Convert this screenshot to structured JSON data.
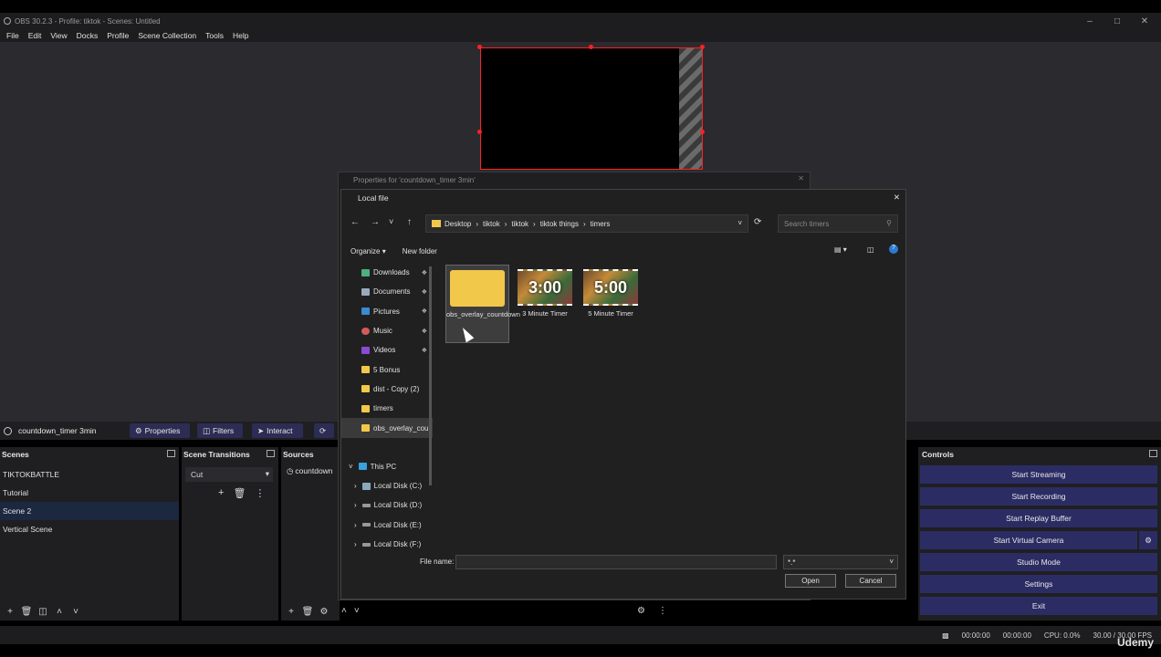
{
  "window": {
    "title": "OBS 30.2.3 - Profile: tiktok - Scenes: Untitled"
  },
  "menu": [
    "File",
    "Edit",
    "View",
    "Docks",
    "Profile",
    "Scene Collection",
    "Tools",
    "Help"
  ],
  "source_bar": {
    "name": "countdown_timer 3min",
    "properties": "Properties",
    "filters": "Filters",
    "interact": "Interact"
  },
  "scenes": {
    "title": "Scenes",
    "items": [
      "TIKTOKBATTLE",
      "Tutorial",
      "Scene 2",
      "Vertical Scene"
    ],
    "selected": 2
  },
  "transitions": {
    "title": "Scene Transitions",
    "value": "Cut"
  },
  "sources": {
    "title": "Sources",
    "items": [
      "countdown"
    ]
  },
  "controls": {
    "title": "Controls",
    "buttons": [
      "Start Streaming",
      "Start Recording",
      "Start Replay Buffer",
      "Start Virtual Camera",
      "Studio Mode",
      "Settings",
      "Exit"
    ]
  },
  "status": {
    "rec_time1": "00:00:00",
    "rec_time2": "00:00:00",
    "cpu": "CPU: 0.0%",
    "fps": "30.00 / 30.00 FPS"
  },
  "watermark": "Udemy",
  "properties_dialog": {
    "title": "Properties for 'countdown_timer 3min'"
  },
  "file_dialog": {
    "title": "Local file",
    "path": [
      "Desktop",
      "tiktok",
      "tiktok",
      "tiktok things",
      "timers"
    ],
    "search_placeholder": "Search timers",
    "organize": "Organize",
    "new_folder": "New folder",
    "nav": [
      {
        "label": "Downloads",
        "pinned": true
      },
      {
        "label": "Documents",
        "pinned": true
      },
      {
        "label": "Pictures",
        "pinned": true
      },
      {
        "label": "Music",
        "pinned": true
      },
      {
        "label": "Videos",
        "pinned": true
      },
      {
        "label": "5 Bonus",
        "pinned": false
      },
      {
        "label": "dist - Copy (2)",
        "pinned": false
      },
      {
        "label": "timers",
        "pinned": false
      },
      {
        "label": "obs_overlay_cou",
        "pinned": false
      }
    ],
    "this_pc": "This PC",
    "drives": [
      "Local Disk (C:)",
      "Local Disk (D:)",
      "Local Disk (E:)",
      "Local Disk (F:)"
    ],
    "files": [
      {
        "name": "obs_overlay_countdown",
        "kind": "folder"
      },
      {
        "name": "3 Minute Timer",
        "kind": "video",
        "thumb": "3:00"
      },
      {
        "name": "5 Minute Timer",
        "kind": "video",
        "thumb": "5:00"
      }
    ],
    "file_name_label": "File name:",
    "file_name_value": "",
    "file_type": "*.*",
    "open": "Open",
    "cancel": "Cancel"
  },
  "colors": {
    "accent_button": "#2c2c64",
    "selection_red": "#ff2020",
    "folder": "#f2c84b"
  }
}
